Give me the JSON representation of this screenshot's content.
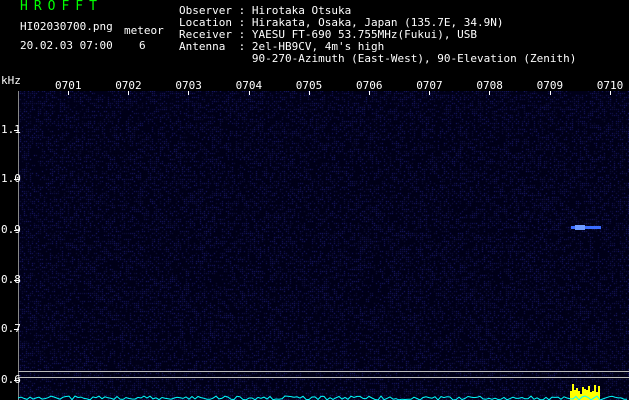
{
  "header": {
    "app_title": "HROFFT",
    "filename": "HI02030700.png",
    "timestamp": "20.02.03 07:00",
    "meteor_label": "meteor",
    "meteor_count": "6",
    "info_lines": [
      "Observer : Hirotaka Otsuka",
      "Location : Hirakata, Osaka, Japan (135.7E, 34.9N)",
      "Receiver : YAESU FT-690 53.755MHz(Fukui), USB",
      "Antenna  : 2el-HB9CV, 4m's high",
      "           90-270-Azimuth (East-West), 90-Elevation (Zenith)"
    ]
  },
  "chart_data": {
    "type": "heatmap",
    "xlabel": "",
    "ylabel": "kHz",
    "x_ticks": [
      "0701",
      "0702",
      "0703",
      "0704",
      "0705",
      "0706",
      "0707",
      "0708",
      "0709",
      "0710"
    ],
    "y_ticks": [
      "1.1",
      "1.0",
      "0.9",
      "0.8",
      "0.7",
      "0.6"
    ],
    "ylim": [
      0.58,
      1.18
    ],
    "echo_events": [
      {
        "time_minute": 9.4,
        "frequency_khz": 0.9
      }
    ],
    "colors": {
      "background": "#000018",
      "noise": "#1c1c80",
      "echo": "#3a6cff",
      "baseline": "#00ffff",
      "burst": "#ffff00",
      "title": "#00ff00"
    }
  }
}
